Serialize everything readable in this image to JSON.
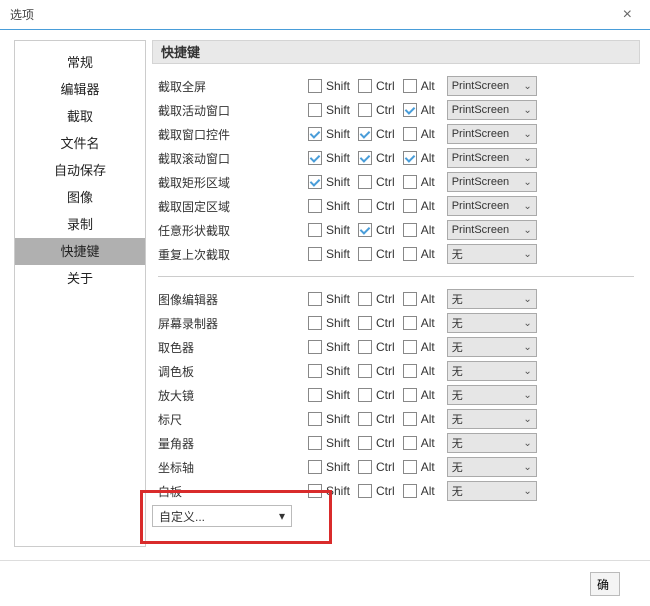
{
  "window": {
    "title": "选项",
    "close": "×"
  },
  "sidebar": [
    "常规",
    "编辑器",
    "截取",
    "文件名",
    "自动保存",
    "图像",
    "录制",
    "快捷键",
    "关于"
  ],
  "sidebar_active": 7,
  "header": "快捷键",
  "mod_labels": {
    "shift": "Shift",
    "ctrl": "Ctrl",
    "alt": "Alt"
  },
  "group1": [
    {
      "label": "截取全屏",
      "shift": false,
      "ctrl": false,
      "alt": false,
      "key": "PrintScreen"
    },
    {
      "label": "截取活动窗口",
      "shift": false,
      "ctrl": false,
      "alt": true,
      "key": "PrintScreen"
    },
    {
      "label": "截取窗口控件",
      "shift": true,
      "ctrl": true,
      "alt": false,
      "key": "PrintScreen"
    },
    {
      "label": "截取滚动窗口",
      "shift": true,
      "ctrl": true,
      "alt": true,
      "key": "PrintScreen"
    },
    {
      "label": "截取矩形区域",
      "shift": true,
      "ctrl": false,
      "alt": false,
      "key": "PrintScreen"
    },
    {
      "label": "截取固定区域",
      "shift": false,
      "ctrl": false,
      "alt": false,
      "key": "PrintScreen"
    },
    {
      "label": "任意形状截取",
      "shift": false,
      "ctrl": true,
      "alt": false,
      "key": "PrintScreen"
    },
    {
      "label": "重复上次截取",
      "shift": false,
      "ctrl": false,
      "alt": false,
      "key": "无"
    }
  ],
  "group2": [
    {
      "label": "图像编辑器",
      "shift": false,
      "ctrl": false,
      "alt": false,
      "key": "无"
    },
    {
      "label": "屏幕录制器",
      "shift": false,
      "ctrl": false,
      "alt": false,
      "key": "无"
    },
    {
      "label": "取色器",
      "shift": false,
      "ctrl": false,
      "alt": false,
      "key": "无"
    },
    {
      "label": "调色板",
      "shift": false,
      "ctrl": false,
      "alt": false,
      "key": "无"
    },
    {
      "label": "放大镜",
      "shift": false,
      "ctrl": false,
      "alt": false,
      "key": "无"
    },
    {
      "label": "标尺",
      "shift": false,
      "ctrl": false,
      "alt": false,
      "key": "无"
    },
    {
      "label": "量角器",
      "shift": false,
      "ctrl": false,
      "alt": false,
      "key": "无"
    },
    {
      "label": "坐标轴",
      "shift": false,
      "ctrl": false,
      "alt": false,
      "key": "无"
    },
    {
      "label": "白板",
      "shift": false,
      "ctrl": false,
      "alt": false,
      "key": "无"
    }
  ],
  "custom_label": "自定义...",
  "footer_btn": "确"
}
